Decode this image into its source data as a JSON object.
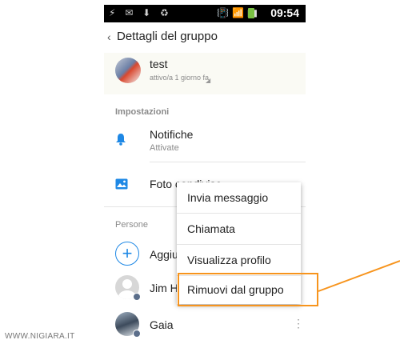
{
  "statusbar": {
    "left_icons": "⚡ ✉ ⬇ ♻",
    "right_icons": "📳 📶 ▮▮",
    "battery_icon": "battery-icon",
    "time": "09:54"
  },
  "header": {
    "back_icon": "chevron-left-icon",
    "back_glyph": "‹",
    "title": "Dettagli del gruppo"
  },
  "group": {
    "name": "test",
    "status": "attivo/a 1 giorno fa",
    "corner_glyph": "◢"
  },
  "settings": {
    "section_label": "Impostazioni",
    "notifications": {
      "title": "Notifiche",
      "subtitle": "Attivate",
      "icon": "bell-icon",
      "glyph": "🔔"
    },
    "photos": {
      "title": "Foto condivise",
      "icon": "image-icon",
      "glyph": "🖼"
    }
  },
  "people": {
    "section_label": "Persone",
    "add": {
      "label": "Aggiungi",
      "glyph": "+"
    },
    "members": [
      {
        "name": "Jim Hi"
      },
      {
        "name": "Gaia",
        "more_glyph": "⋮"
      }
    ]
  },
  "context_menu": {
    "items": [
      {
        "label": "Invia messaggio"
      },
      {
        "label": "Chiamata"
      },
      {
        "label": "Visualizza profilo"
      },
      {
        "label": "Rimuovi dal gruppo"
      }
    ]
  },
  "annotation": {
    "color": "#f7941d",
    "highlighted_item": "Rimuovi dal gruppo"
  },
  "watermark": "WWW.NIGIARA.IT",
  "colors": {
    "accent": "#1e88e5",
    "orange": "#f7941d"
  }
}
